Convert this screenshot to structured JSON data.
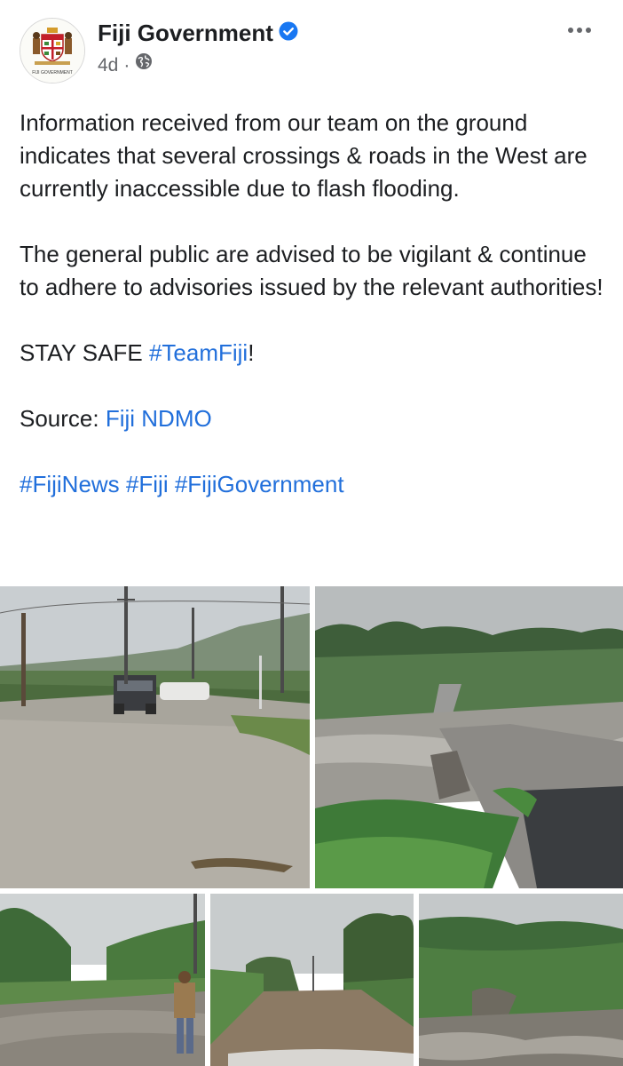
{
  "header": {
    "page_name": "Fiji Government",
    "time": "4d",
    "separator": "·",
    "avatar_caption": "FIJI GOVERNMENT"
  },
  "post": {
    "para1": "Information received from our team on the ground indicates that several crossings & roads in the West are currently inaccessible due to flash flooding.",
    "para2": "The general public are advised to be vigilant & continue to adhere to advisories issued by the relevant authorities!",
    "stay_safe_prefix": "STAY SAFE ",
    "stay_safe_hashtag": "#TeamFiji",
    "stay_safe_suffix": "!",
    "source_prefix": "Source: ",
    "source_link": "Fiji NDMO",
    "hashtags": [
      "#FijiNews",
      "#Fiji",
      "#FijiGovernment"
    ]
  },
  "colors": {
    "link": "#216fdb",
    "verified": "#1877f2",
    "meta": "#65676b"
  },
  "icons": [
    "verified-badge-icon",
    "globe-icon",
    "more-options-icon"
  ],
  "photos": [
    "flooded-road-photo",
    "washed-out-crossing-photo",
    "flooded-street-photo",
    "flooded-lane-photo",
    "flooded-crossing-photo"
  ]
}
